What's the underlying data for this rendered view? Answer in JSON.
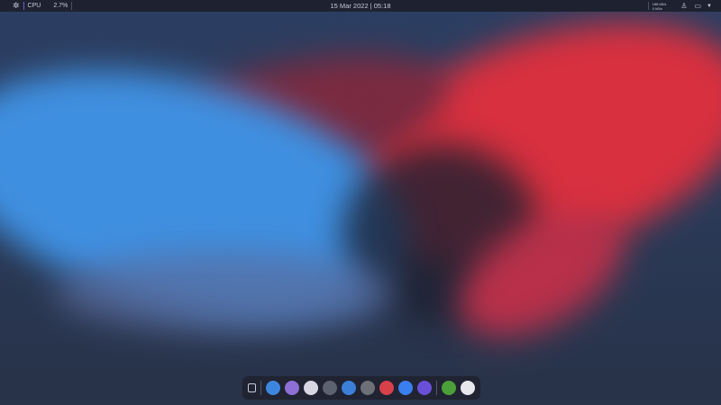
{
  "topbar": {
    "cpu_label": "CPU",
    "cpu_value": "2.7%",
    "datetime": "15 Mar 2022 | 05:18",
    "net_up": "188 kB/s",
    "net_down": "0 kB/s"
  },
  "dock": {
    "apps": [
      {
        "name": "files",
        "color": "#3d86e0"
      },
      {
        "name": "mail",
        "color": "#8d6fd6"
      },
      {
        "name": "photos",
        "color": "#d9d6e4"
      },
      {
        "name": "terminal",
        "color": "#5d6270"
      },
      {
        "name": "browser",
        "color": "#3b7fd8"
      },
      {
        "name": "camera",
        "color": "#6e7078"
      },
      {
        "name": "music",
        "color": "#d8404a"
      },
      {
        "name": "store",
        "color": "#3a7ff0"
      },
      {
        "name": "themes",
        "color": "#6a4fd8"
      },
      {
        "name": "app-green",
        "color": "#4ca03a"
      },
      {
        "name": "app-web",
        "color": "#e8e8ec"
      }
    ]
  }
}
